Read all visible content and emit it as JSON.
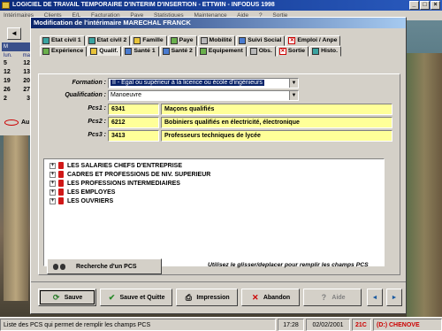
{
  "app": {
    "title": "LOGICIEL DE TRAVAIL TEMPORAIRE D'INTERIM D'INSERTION - ETTWIN - INFODUS 1998",
    "menu": [
      "Intérimaires",
      "Clients",
      "E/L",
      "Facturation",
      "Paye",
      "Statistiques",
      "Maintenance",
      "Aide",
      "?",
      "Sortie"
    ],
    "window_buttons": [
      "_",
      "□",
      "×"
    ]
  },
  "calendar": {
    "month_label": "M",
    "nav_icon": "arrow-left",
    "dows": [
      "lun.",
      "ma"
    ],
    "rows": [
      [
        "5",
        "12"
      ],
      [
        "12",
        "13"
      ],
      [
        "19",
        "20"
      ],
      [
        "26",
        "27"
      ],
      [
        "2",
        "3"
      ]
    ],
    "footer": "Au"
  },
  "dialog": {
    "title": "Modification de l'intérimaire MARECHAL FRANCK",
    "tabs_row1": [
      {
        "label": "Etat civil 1",
        "icon": "card-icon"
      },
      {
        "label": "Etat civil 2",
        "icon": "card-icon"
      },
      {
        "label": "Famille",
        "icon": "family-icon"
      },
      {
        "label": "Paye",
        "icon": "money-icon"
      },
      {
        "label": "Mobilité",
        "icon": "car-icon"
      },
      {
        "label": "Suivi Social",
        "icon": "social-icon"
      },
      {
        "label": "Emploi / Anpe",
        "icon": "job-icon"
      }
    ],
    "tabs_row2": [
      {
        "label": "Expérience",
        "icon": "book-icon"
      },
      {
        "label": "Qualif.",
        "icon": "qualif-icon"
      },
      {
        "label": "Santé 1",
        "icon": "health-icon"
      },
      {
        "label": "Santé 2",
        "icon": "health-icon"
      },
      {
        "label": "Equipement",
        "icon": "equipment-icon"
      },
      {
        "label": "Obs.",
        "icon": "note-icon"
      },
      {
        "label": "Sortie",
        "icon": "cross-icon"
      },
      {
        "label": "Histo.",
        "icon": "history-icon"
      }
    ],
    "form": {
      "formation_label": "Formation :",
      "formation_value": "II - Egal ou supérieur à la licence ou école d'ingénieurs",
      "qualification_label": "Qualification :",
      "qualification_value": "Manoeuvre",
      "pcs": [
        {
          "label": "Pcs1 :",
          "code": "6341",
          "desc": "Maçons qualifiés"
        },
        {
          "label": "Pcs2 :",
          "code": "6212",
          "desc": "Bobiniers qualifiés en électricité, électronique"
        },
        {
          "label": "Pcs3 :",
          "code": "3413",
          "desc": "Professeurs techniques de lycée"
        }
      ]
    },
    "tree": [
      "LES SALARIES CHEFS D'ENTREPRISE",
      "CADRES ET PROFESSIONS DE NIV. SUPERIEUR",
      "LES PROFESSIONS INTERMEDIAIRES",
      "LES EMPLOYES",
      "LES OUVRIERS"
    ],
    "search_button": "Recherche d'un PCS",
    "hint": "Utilisez le glisser/deplacer pour remplir les champs PCS",
    "actions": {
      "save": "Sauve",
      "save_quit": "Sauve et Quitte",
      "print": "Impression",
      "cancel": "Abandon",
      "help": "Aide",
      "prev": "◄",
      "next": "►"
    }
  },
  "status": {
    "message": "Liste des PCS qui permet de remplir les champs PCS",
    "time": "17:28",
    "date": "02/02/2001",
    "code": "21C",
    "drive": "(D:) CHENOVE"
  },
  "colors": {
    "titlebar": "#0a246a",
    "field_highlight": "#ffff99",
    "tree_icon": "#d01818"
  }
}
